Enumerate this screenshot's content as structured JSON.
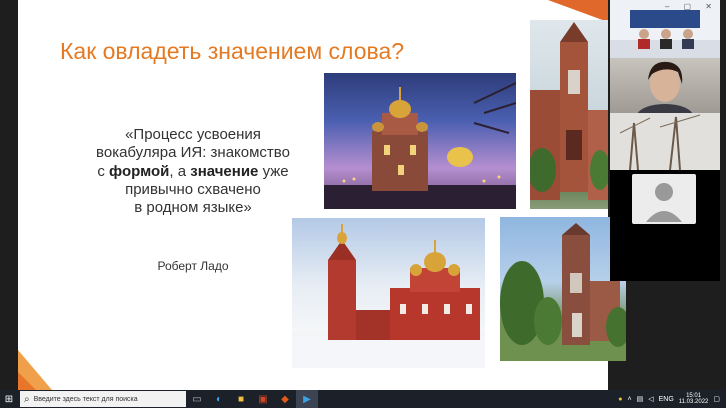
{
  "slide": {
    "title": "Как овладеть значением слова?",
    "quote_parts": {
      "l1": "«Процесс усвоения",
      "l2": "вокабуляра ИЯ: знакомство",
      "l3_pre": "с ",
      "l3_bold1": "формой",
      "l3_mid": ", а ",
      "l3_bold2": "значение",
      "l3_post": " уже",
      "l4": "привычно схвачено",
      "l5": "в родном языке»"
    },
    "author": "Роберт Ладо"
  },
  "taskbar": {
    "search_placeholder": "Введите здесь текст для поиска",
    "lang": "ENG",
    "time": "15:01",
    "date": "11.03.2022"
  },
  "colors": {
    "title": "#e57a22",
    "accent": "#e0682a",
    "taskbar": "#1c2029"
  }
}
